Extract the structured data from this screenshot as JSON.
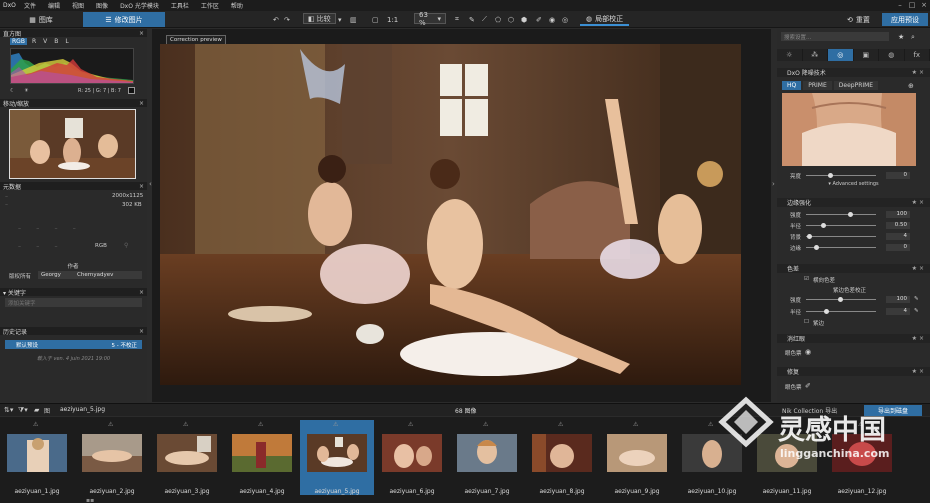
{
  "menubar": {
    "logo": "DxO",
    "items": [
      "文件",
      "编辑",
      "视图",
      "图像",
      "DxO 光学模块",
      "工具栏",
      "工作区",
      "帮助"
    ]
  },
  "toolbar": {
    "library_tab": "图库",
    "customize_tab": "修改图片",
    "compare": "比较",
    "zoom_label": "1:1",
    "zoom_value": "63 %",
    "local_adjust": "局部校正",
    "reset": "重置",
    "apply_preset": "应用预设"
  },
  "left": {
    "histogram_title": "直方图",
    "hist_tabs": [
      "RGB",
      "R",
      "V",
      "B",
      "L"
    ],
    "hist_rgb_readout": "R: 25 | G: 7 | B: 7",
    "navigator_title": "移动/缩放",
    "metadata_title": "元数据",
    "dimensions": "2000x1125",
    "filesize": "302 KB",
    "rgb_label": "RGB",
    "author_label": "作者",
    "copyright_label": "版权所有",
    "author_first": "Georgy",
    "author_last": "Chernyadyev",
    "keywords_title": "关键字",
    "keywords_placeholder": "添加关键字",
    "history_title": "历史记录",
    "history_item": "默认预设",
    "history_item_status": "5 - 不校正",
    "history_note": "载入于 ven. 4 juin 2021 19:00"
  },
  "viewer": {
    "preview_label": "Correction preview"
  },
  "right": {
    "search_placeholder": "搜索设置...",
    "tabs_icons": [
      "sun-icon",
      "triangles-icon",
      "lens-icon",
      "square-icon",
      "grid-icon",
      "fx-icon"
    ],
    "noise_title": "DxO 降噪技术",
    "nr_modes": [
      "HQ",
      "PRIME",
      "DeepPRIME"
    ],
    "luminance_label": "亮度",
    "luminance_value": "0",
    "advanced_settings": "Advanced settings",
    "vignette_title": "边缘强化",
    "vignette_rows": [
      {
        "label": "强度",
        "value": "100",
        "frac": 0.64
      },
      {
        "label": "半径",
        "value": "0.50",
        "frac": 0.22
      },
      {
        "label": "背景",
        "value": "4",
        "frac": 0.01
      },
      {
        "label": "边缘",
        "value": "0",
        "frac": 0.12
      }
    ],
    "chroma_title": "色差",
    "chroma_option": "横向色差",
    "purple_fringe": "紫边色差校正",
    "chroma_rows": [
      {
        "label": "强度",
        "value": "100",
        "frac": 0.48
      },
      {
        "label": "半径",
        "value": "4",
        "frac": 0.28
      }
    ],
    "purple_option": "紫边",
    "unsharp_title": "消红眼",
    "unsharp_label": "眼色票",
    "moire_title": "修复",
    "moire_label": "眼色票"
  },
  "filmstrip": {
    "current_file": "aeziyuan_5.jpg",
    "count": "68 图像",
    "filter_label": "Nik Collection  导出",
    "export_button": "导出到磁盘",
    "selected_index": 4,
    "files": [
      "aeziyuan_1.jpg",
      "aeziyuan_2.jpg",
      "aeziyuan_3.jpg",
      "aeziyuan_4.jpg",
      "aeziyuan_5.jpg",
      "aeziyuan_6.jpg",
      "aeziyuan_7.jpg",
      "aeziyuan_8.jpg",
      "aeziyuan_9.jpg",
      "aeziyuan_10.jpg",
      "aeziyuan_11.jpg",
      "aeziyuan_12.jpg"
    ]
  },
  "watermark": {
    "brand": "灵感中国",
    "url": "lingganchina.com"
  },
  "colors": {
    "accent": "#2f6ea3",
    "panel": "#2a2a2a",
    "dark": "#1b1b1b"
  }
}
